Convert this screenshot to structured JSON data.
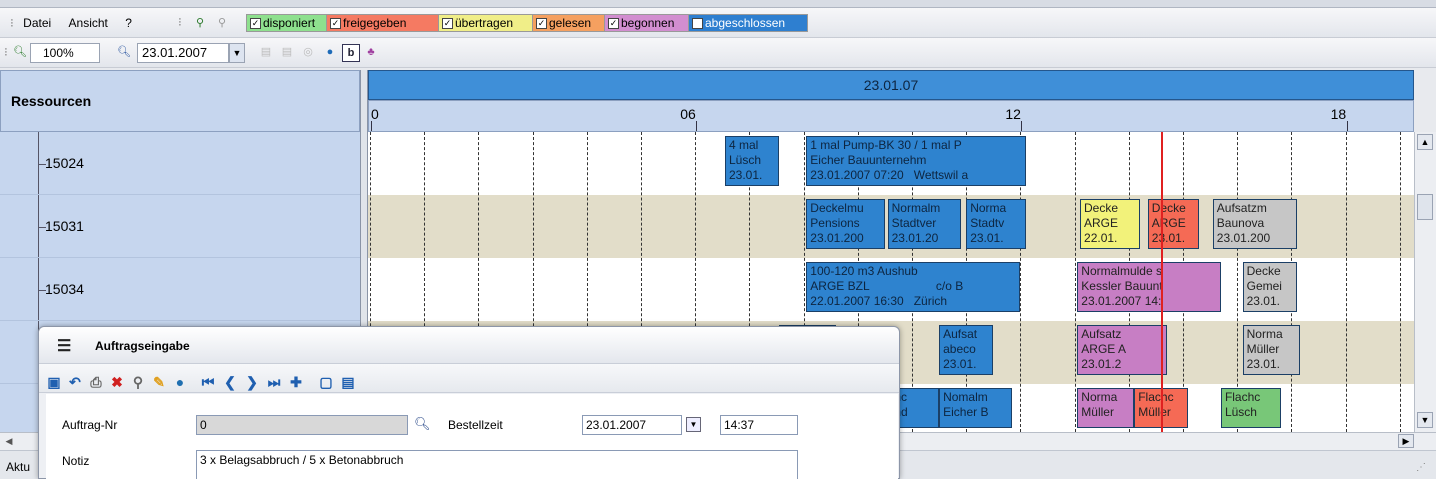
{
  "menu": {
    "file": "Datei",
    "view": "Ansicht",
    "help": "?"
  },
  "legend": [
    {
      "label": "disponiert",
      "color": "#8ee08e"
    },
    {
      "label": "freigegeben",
      "color": "#f57a62"
    },
    {
      "label": "übertragen",
      "color": "#f0ee88"
    },
    {
      "label": "gelesen",
      "color": "#f5a060"
    },
    {
      "label": "begonnen",
      "color": "#d28ed0"
    },
    {
      "label": "abgeschlossen",
      "color": "#2e7fd0"
    }
  ],
  "toolbar2": {
    "zoom": "100%",
    "date": "23.01.2007"
  },
  "gantt": {
    "resources_header": "Ressourcen",
    "date_header": "23.01.07",
    "hours": [
      {
        "label": "0",
        "hour": 0
      },
      {
        "label": "06",
        "hour": 6
      },
      {
        "label": "12",
        "hour": 12
      },
      {
        "label": "18",
        "hour": 18
      }
    ],
    "resources": [
      "15024",
      "15031",
      "15034",
      "",
      ""
    ],
    "tasks": [
      {
        "row": 0,
        "start": 6.55,
        "end": 7.55,
        "color": "blue",
        "lines": [
          "4 mal",
          "Lüsch",
          "23.01."
        ]
      },
      {
        "row": 0,
        "start": 8.05,
        "end": 12.1,
        "color": "blue",
        "lines": [
          "1 mal Pump-BK 30 / 1 mal P",
          "Eicher Bauunternehm",
          "23.01.2007 07:20   Wettswil a"
        ]
      },
      {
        "row": 1,
        "start": 8.05,
        "end": 9.5,
        "color": "blue",
        "lines": [
          "Deckelmu",
          "Pensions",
          "23.01.200"
        ]
      },
      {
        "row": 1,
        "start": 9.55,
        "end": 10.9,
        "color": "blue",
        "lines": [
          "Normalm",
          "Stadtver",
          "23.01.20"
        ]
      },
      {
        "row": 1,
        "start": 11.0,
        "end": 12.1,
        "color": "blue",
        "lines": [
          "Norma",
          "Stadtv",
          "23.01."
        ]
      },
      {
        "row": 1,
        "start": 13.1,
        "end": 14.2,
        "color": "yellow",
        "lines": [
          "Decke",
          "ARGE",
          "22.01."
        ]
      },
      {
        "row": 1,
        "start": 14.35,
        "end": 15.3,
        "color": "orange",
        "lines": [
          "Decke",
          "ARGE",
          "23.01."
        ]
      },
      {
        "row": 1,
        "start": 15.55,
        "end": 17.1,
        "color": "grey",
        "lines": [
          "Aufsatzm",
          "Baunova",
          "23.01.200"
        ]
      },
      {
        "row": 2,
        "start": 8.05,
        "end": 12.0,
        "color": "blue",
        "lines": [
          "100-120 m3 Aushub",
          "ARGE BZL                    c/o B",
          "22.01.2007 16:30   Zürich"
        ]
      },
      {
        "row": 2,
        "start": 13.05,
        "end": 15.7,
        "color": "purple",
        "lines": [
          "Normalmulde s",
          "Kessler Bauunt",
          "23.01.2007 14:"
        ]
      },
      {
        "row": 2,
        "start": 16.1,
        "end": 17.1,
        "color": "grey",
        "lines": [
          "Decke",
          "Gemei",
          "23.01."
        ]
      },
      {
        "row": 3,
        "start": 7.55,
        "end": 8.6,
        "color": "blue",
        "lines": [
          "",
          "",
          ""
        ]
      },
      {
        "row": 3,
        "start": 10.5,
        "end": 11.5,
        "color": "blue",
        "lines": [
          "Aufsat",
          "abeco",
          "23.01."
        ]
      },
      {
        "row": 3,
        "start": 13.05,
        "end": 14.7,
        "color": "purple",
        "lines": [
          "Aufsatz",
          "ARGE A",
          "23.01.2"
        ]
      },
      {
        "row": 3,
        "start": 16.1,
        "end": 17.15,
        "color": "grey",
        "lines": [
          "Norma",
          "Müller",
          "23.01."
        ]
      },
      {
        "row": 4,
        "start": 9.6,
        "end": 10.5,
        "color": "blue",
        "lines": [
          "hc",
          "nd"
        ]
      },
      {
        "row": 4,
        "start": 10.5,
        "end": 11.85,
        "color": "blue",
        "lines": [
          "Nomalm",
          "Eicher B"
        ]
      },
      {
        "row": 4,
        "start": 13.05,
        "end": 14.1,
        "color": "purple",
        "lines": [
          "Norma",
          "Müller"
        ]
      },
      {
        "row": 4,
        "start": 14.1,
        "end": 15.1,
        "color": "orange",
        "lines": [
          "Flachc",
          "Müller"
        ]
      },
      {
        "row": 4,
        "start": 15.7,
        "end": 16.8,
        "color": "green",
        "lines": [
          "Flachc",
          "Lüsch"
        ]
      }
    ],
    "now_hour": 14.6
  },
  "status_bar": {
    "left": "Aktu"
  },
  "dialog": {
    "title": "Auftragseingabe",
    "order_nr_label": "Auftrag-Nr",
    "order_nr_value": "0",
    "order_time_label": "Bestellzeit",
    "order_date": "23.01.2007",
    "order_time": "14:37",
    "note_label": "Notiz",
    "note_value": "3 x Belagsabbruch / 5 x Betonabbruch"
  }
}
